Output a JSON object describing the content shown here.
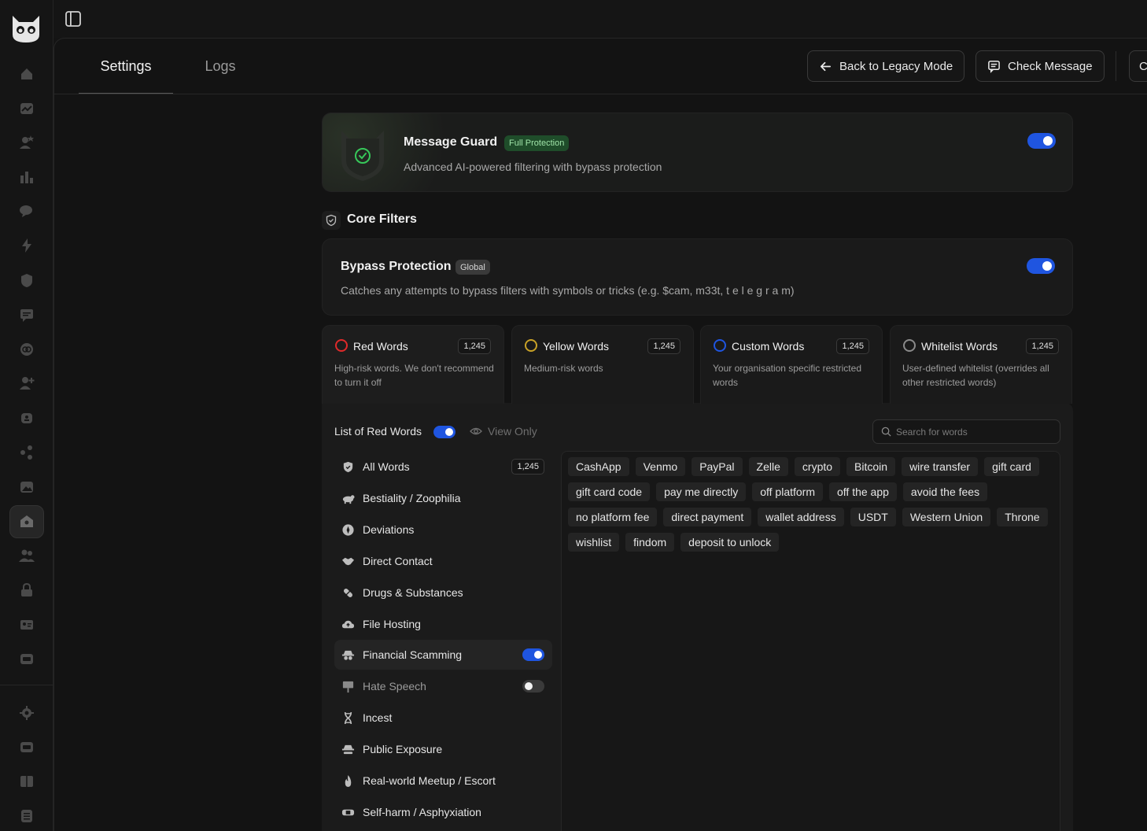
{
  "tabs": [
    {
      "label": "Settings",
      "active": true
    },
    {
      "label": "Logs",
      "active": false
    }
  ],
  "header": {
    "legacy_label": "Back to Legacy Mode",
    "check_label": "Check Message",
    "third_label": "C"
  },
  "guard": {
    "title": "Message Guard",
    "badge": "Full Protection",
    "subtitle": "Advanced AI-powered filtering with bypass protection",
    "enabled": true
  },
  "core_filters": {
    "title": "Core Filters"
  },
  "bypass": {
    "title": "Bypass Protection",
    "badge": "Global",
    "subtitle": "Catches any attempts to bypass filters with symbols or tricks (e.g. $cam, m33t, t e l e g r a m)",
    "enabled": true
  },
  "word_cards": [
    {
      "title": "Red Words",
      "count": "1,245",
      "desc": "High-risk words. We don't recommend to turn it off",
      "color": "#e02a2a"
    },
    {
      "title": "Yellow Words",
      "count": "1,245",
      "desc": "Medium-risk words",
      "color": "#c9a227"
    },
    {
      "title": "Custom Words",
      "count": "1,245",
      "desc": "Your organisation specific restricted words",
      "color": "#1f55e0"
    },
    {
      "title": "Whitelist Words",
      "count": "1,245",
      "desc": "User-defined whitelist (overrides all other restricted words)",
      "color": "#8a8a8a"
    }
  ],
  "list": {
    "title": "List of Red Words",
    "view_only": "View Only",
    "search_placeholder": "Search for words"
  },
  "categories": [
    {
      "label": "All Words",
      "count": "1,245",
      "icon": "shield-icon"
    },
    {
      "label": "Bestiality / Zoophilia",
      "icon": "animal-icon"
    },
    {
      "label": "Deviations",
      "icon": "compass-icon"
    },
    {
      "label": "Direct Contact",
      "icon": "handshake-icon"
    },
    {
      "label": "Drugs & Substances",
      "icon": "pill-icon"
    },
    {
      "label": "File Hosting",
      "icon": "cloud-upload-icon"
    },
    {
      "label": "Financial Scamming",
      "icon": "spy-icon",
      "toggle": true
    },
    {
      "label": "Hate Speech",
      "icon": "protest-sign-icon",
      "toggle": false
    },
    {
      "label": "Incest",
      "icon": "dna-icon"
    },
    {
      "label": "Public Exposure",
      "icon": "incognito-icon"
    },
    {
      "label": "Real-world Meetup / Escort",
      "icon": "flame-icon"
    },
    {
      "label": "Self-harm / Asphyxiation",
      "icon": "bandage-icon"
    }
  ],
  "words": [
    "CashApp",
    "Venmo",
    "PayPal",
    "Zelle",
    "crypto",
    "Bitcoin",
    "wire transfer",
    "gift card",
    "gift card code",
    "pay me directly",
    "off platform",
    "off the app",
    "avoid the fees",
    "no platform fee",
    "direct payment",
    "wallet address",
    "USDT",
    "Western Union",
    "Throne",
    "wishlist",
    "findom",
    "deposit to unlock"
  ]
}
